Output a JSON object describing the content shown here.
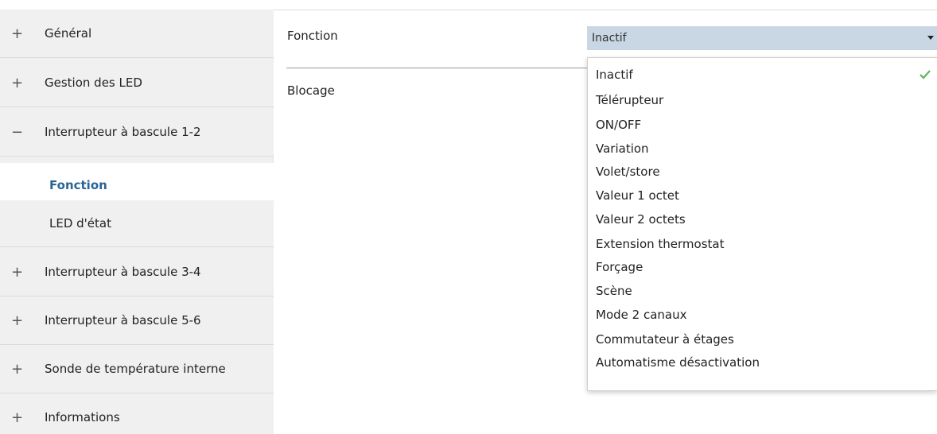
{
  "sidebar": {
    "items": [
      {
        "sign": "+",
        "label": "Général"
      },
      {
        "sign": "+",
        "label": "Gestion des LED"
      },
      {
        "sign": "−",
        "label": "Interrupteur à bascule  1-2"
      },
      {
        "sign": "",
        "label": "Fonction"
      },
      {
        "sign": "",
        "label": "LED d'état"
      },
      {
        "sign": "+",
        "label": "Interrupteur à bascule  3-4"
      },
      {
        "sign": "+",
        "label": "Interrupteur à bascule  5-6"
      },
      {
        "sign": "+",
        "label": "Sonde de température interne"
      },
      {
        "sign": "+",
        "label": "Informations"
      }
    ]
  },
  "params": {
    "fonction_label": "Fonction",
    "blocage_label": "Blocage"
  },
  "select": {
    "value": "Inactif"
  },
  "dropdown": {
    "options": [
      "Inactif",
      "Télérupteur",
      "ON/OFF",
      "Variation",
      "Volet/store",
      "Valeur 1 octet",
      "Valeur 2 octets",
      "Extension thermostat",
      "Forçage",
      "Scène",
      "Mode 2 canaux",
      "Commutateur à étages",
      "Automatisme désactivation"
    ],
    "selected_index": 0
  },
  "colors": {
    "active_label": "#2a6496",
    "select_bg": "#c9d6e3",
    "check": "#5cb85c"
  }
}
